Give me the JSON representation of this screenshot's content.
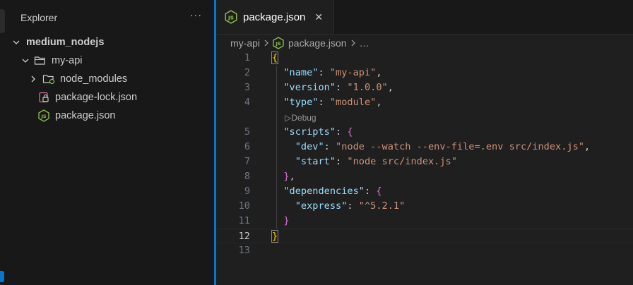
{
  "sidebar": {
    "title": "Explorer",
    "more": "···",
    "root": "medium_nodejs",
    "folder": "my-api",
    "items": [
      {
        "label": "node_modules"
      },
      {
        "label": "package-lock.json"
      },
      {
        "label": "package.json"
      }
    ]
  },
  "editor": {
    "tab": {
      "label": "package.json",
      "close": "✕"
    },
    "breadcrumbs": {
      "folder": "my-api",
      "file": "package.json",
      "more": "…"
    },
    "codelens": "▷Debug",
    "line_numbers": [
      "1",
      "2",
      "3",
      "4",
      "5",
      "6",
      "7",
      "8",
      "9",
      "10",
      "11",
      "12",
      "13"
    ],
    "code": {
      "name_key": "\"name\"",
      "name_val": "\"my-api\"",
      "version_key": "\"version\"",
      "version_val": "\"1.0.0\"",
      "type_key": "\"type\"",
      "type_val": "\"module\"",
      "scripts_key": "\"scripts\"",
      "dev_key": "\"dev\"",
      "dev_val": "\"node --watch --env-file=.env src/index.js\"",
      "start_key": "\"start\"",
      "start_val": "\"node src/index.js\"",
      "deps_key": "\"dependencies\"",
      "express_key": "\"express\"",
      "express_val": "\"^5.2.1\""
    }
  },
  "colors": {
    "accent": "#0078d4",
    "json_key": "#9cdcfe",
    "json_string": "#ce9178",
    "bracket_level1": "#ffd700",
    "bracket_level2": "#da70d6",
    "js_icon": "#8dc149"
  }
}
